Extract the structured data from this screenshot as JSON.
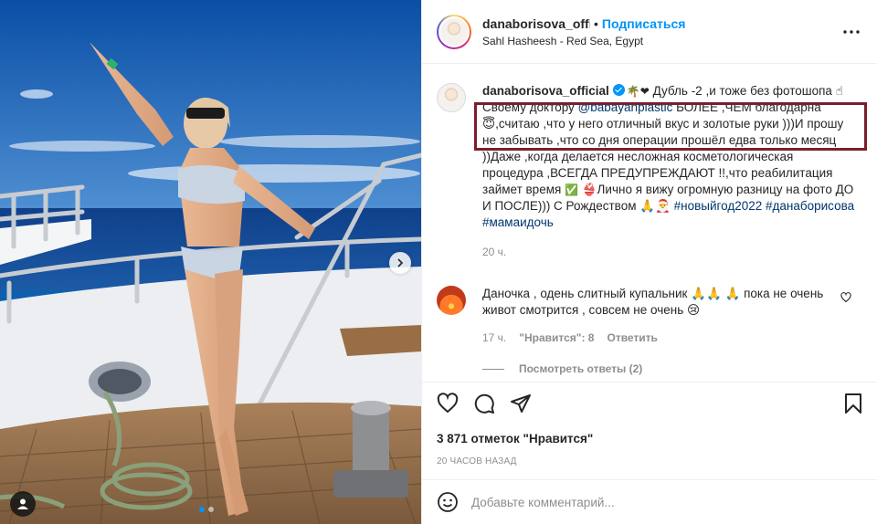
{
  "post": {
    "username": "danaborisova_offic",
    "separator": "•",
    "follow_label": "Подписаться",
    "location": "Sahl Hasheesh - Red Sea, Egypt"
  },
  "caption": {
    "username": "danaborisova_official",
    "emoji_after_name": "🌴❤",
    "text_1": "Дубль -2 ,и тоже без фотошопа ☝ Своему доктору ",
    "mention": "@babayanplastic",
    "text_2": " БОЛЕЕ ,ЧЕМ благодарна 😇,считаю ,что у него отличный вкус и золотые руки )))И прошу не забывать ,что со дня операции прошёл едва только месяц ))Даже ,когда делается несложная косметологическая процедура ,ВСЕГДА ПРЕДУПРЕЖДАЮТ !!,что реабилитация займет время ",
    "check_emoji": "✅",
    "text_3": " 👙Лично я вижу огромную разницу на фото ДО И ПОСЛЕ))) С Рождеством 🙏🎅 ",
    "hashtag_1": "#новыйгод2022",
    "hashtag_2": "#данаборисова",
    "hashtag_3": "#мамаидочь",
    "time": "20 ч."
  },
  "comment": {
    "text": "Даночка , одень слитный купальник 🙏🙏 🙏 пока не очень живот смотрится , совсем не очень 😢",
    "time": "17 ч.",
    "likes": "\"Нравится\": 8",
    "reply_label": "Ответить",
    "view_replies": "Посмотреть ответы (2)"
  },
  "likes_label": "3 871 отметок \"Нравится\"",
  "posted_label": "20 ЧАСОВ НАЗАД",
  "add_comment_placeholder": "Добавьте комментарий...",
  "icons": [
    "like-icon",
    "comment-icon",
    "share-icon",
    "save-icon",
    "more-icon",
    "emoji-icon",
    "tag-user-icon",
    "next-arrow-icon"
  ],
  "carousel": {
    "slides": 2,
    "active_index": 0
  },
  "colors": {
    "accent": "#0095f6",
    "link": "#00376b",
    "muted": "#8e8e8e",
    "highlight_box": "#7a1f2e"
  }
}
